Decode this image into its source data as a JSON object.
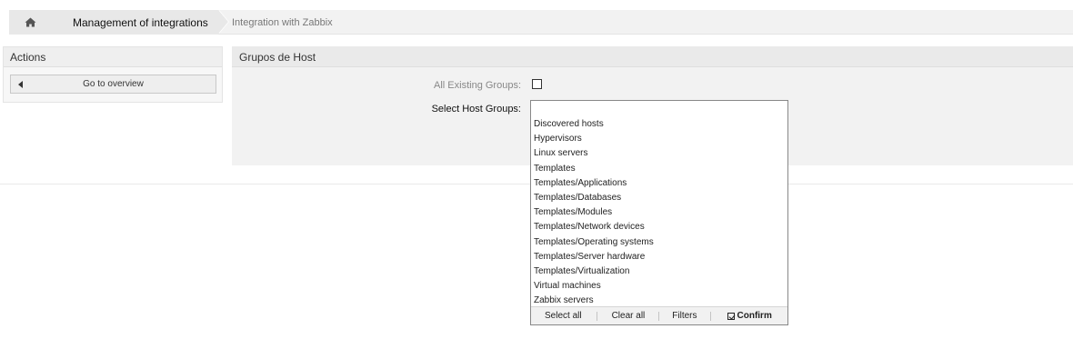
{
  "breadcrumb": {
    "home_icon": "home-icon",
    "item1": "Management of integrations",
    "item2": "Integration with Zabbix"
  },
  "sidebar": {
    "title": "Actions",
    "overview_button": "Go to overview",
    "overview_icon": "caret-left-icon"
  },
  "main": {
    "title": "Grupos de Host",
    "all_groups_label": "All Existing Groups:",
    "all_groups_checked": false,
    "select_label": "Select Host Groups:",
    "select_value": ""
  },
  "dropdown": {
    "options": [
      "Discovered hosts",
      "Hypervisors",
      "Linux servers",
      "Templates",
      "Templates/Applications",
      "Templates/Databases",
      "Templates/Modules",
      "Templates/Network devices",
      "Templates/Operating systems",
      "Templates/Server hardware",
      "Templates/Virtualization",
      "Virtual machines",
      "Zabbix servers"
    ],
    "footer": {
      "select_all": "Select all",
      "clear_all": "Clear all",
      "filters": "Filters",
      "confirm": "Confirm",
      "confirm_icon": "check-square-icon"
    }
  }
}
